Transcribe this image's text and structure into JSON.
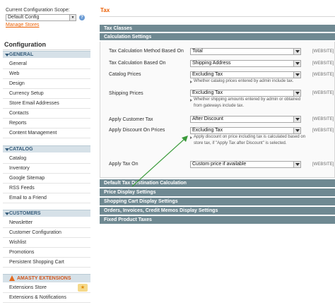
{
  "sidebar": {
    "scope_label": "Current Configuration Scope:",
    "scope_value": "Default Config",
    "manage_stores": "Manage Stores",
    "config_title": "Configuration",
    "groups": [
      {
        "title": "GENERAL",
        "items": [
          "General",
          "Web",
          "Design",
          "Currency Setup",
          "Store Email Addresses",
          "Contacts",
          "Reports",
          "Content Management"
        ]
      },
      {
        "title": "CATALOG",
        "items": [
          "Catalog",
          "Inventory",
          "Google Sitemap",
          "RSS Feeds",
          "Email to a Friend"
        ]
      },
      {
        "title": "CUSTOMERS",
        "items": [
          "Newsletter",
          "Customer Configuration",
          "Wishlist",
          "Promotions",
          "Persistent Shopping Cart"
        ]
      },
      {
        "title": "AMASTY EXTENSIONS",
        "items": [
          "Extensions Store",
          "Extensions & Notifications"
        ]
      }
    ]
  },
  "main": {
    "title": "Tax",
    "sections": [
      "Tax Classes",
      "Calculation Settings"
    ],
    "rows": [
      {
        "label": "Tax Calculation Method Based On",
        "value": "Total",
        "scope": "[WEBSITE]",
        "note": ""
      },
      {
        "label": "Tax Calculation Based On",
        "value": "Shipping Address",
        "scope": "[WEBSITE]",
        "note": ""
      },
      {
        "label": "Catalog Prices",
        "value": "Excluding Tax",
        "scope": "[WEBSITE]",
        "note": "Whether catalog prices entered by admin include tax."
      },
      {
        "label": "Shipping Prices",
        "value": "Excluding Tax",
        "scope": "[WEBSITE]",
        "note": "Whether shipping amounts entered by admin or obtained from gateways include tax."
      },
      {
        "label": "Apply Customer Tax",
        "value": "After Discount",
        "scope": "[WEBSITE]",
        "note": ""
      },
      {
        "label": "Apply Discount On Prices",
        "value": "Excluding Tax",
        "scope": "[WEBSITE]",
        "note": "Apply discount on price including tax is calculated based on store tax, if \"Apply Tax after Discount\" is selected."
      },
      {
        "label": "Apply Tax On",
        "value": "Custom price if available",
        "scope": "[WEBSITE]",
        "note": ""
      }
    ],
    "collapsed_sections": [
      "Default Tax Destination Calculation",
      "Price Display Settings",
      "Shopping Cart Display Settings",
      "Orders, Invoices, Credit Memos Display Settings",
      "Fixed Product Taxes"
    ]
  },
  "colors": {
    "accent": "#eb5e00",
    "section_header": "#6f8992",
    "annotation_arrow": "#3a9a3a"
  }
}
